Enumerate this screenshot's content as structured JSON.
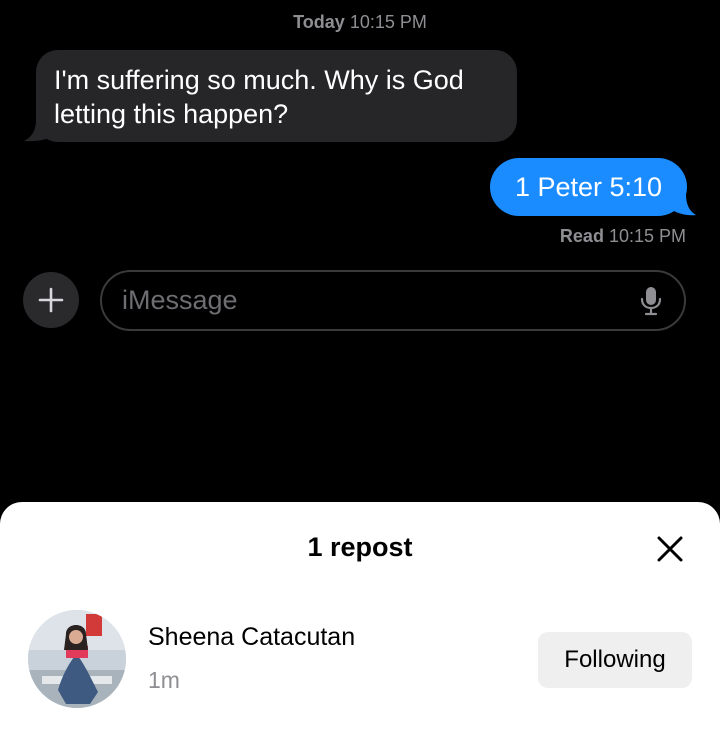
{
  "conversation": {
    "timestamp_day": "Today",
    "timestamp_time": "10:15 PM",
    "messages": [
      {
        "direction": "incoming",
        "text": "I'm suffering so much. Why is God letting this happen?"
      },
      {
        "direction": "outgoing",
        "text": "1 Peter 5:10"
      }
    ],
    "read_label": "Read",
    "read_time": "10:15 PM"
  },
  "composer": {
    "plus_icon": "plus-icon",
    "placeholder": "iMessage",
    "mic_icon": "microphone-icon"
  },
  "repost_sheet": {
    "title": "1 repost",
    "close_icon": "close-icon",
    "users": [
      {
        "name": "Sheena Catacutan",
        "time": "1m",
        "button_label": "Following"
      }
    ]
  },
  "colors": {
    "background": "#000000",
    "incoming_bubble": "#262629",
    "outgoing_bubble": "#1a8cff",
    "secondary_text": "#8e8e93",
    "sheet_background": "#ffffff",
    "following_button": "#efefef"
  }
}
